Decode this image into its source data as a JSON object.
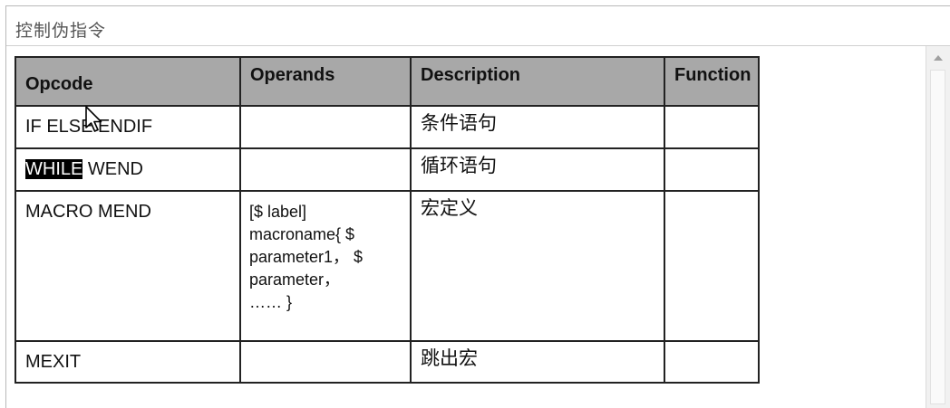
{
  "window": {
    "title": "控制伪指令"
  },
  "table": {
    "headers": [
      "Opcode",
      "Operands",
      "Description",
      "Function"
    ],
    "rows": [
      {
        "opcode": "IF ELSE ENDIF",
        "operands": [],
        "description": "条件语句",
        "function": ""
      },
      {
        "opcode_selected": "WHILE",
        "opcode_rest": " WEND",
        "operands": [],
        "description": "循环语句",
        "function": ""
      },
      {
        "opcode": "MACRO MEND",
        "operands": [
          "[$ label]",
          "macroname{ $",
          "parameter1，  $",
          "parameter，",
          "…… }"
        ],
        "description": "宏定义",
        "function": ""
      },
      {
        "opcode": "MEXIT",
        "operands": [],
        "description": "跳出宏",
        "function": ""
      }
    ]
  },
  "icons": {
    "cursor": "mouse-pointer-icon",
    "scroll_up": "scroll-up-arrow-icon"
  },
  "colors": {
    "header_bg": "#a8a8a8",
    "border": "#222222",
    "selection": "#000000"
  }
}
